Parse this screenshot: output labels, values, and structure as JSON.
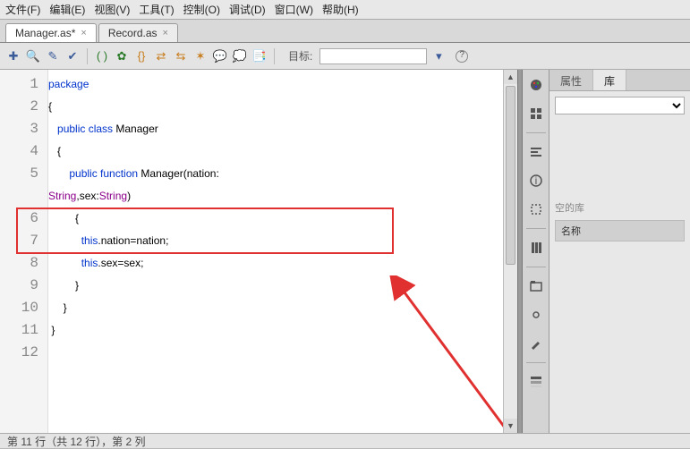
{
  "menu": {
    "file": "文件(F)",
    "edit": "编辑(E)",
    "view": "视图(V)",
    "tools": "工具(T)",
    "control": "控制(O)",
    "debug": "调试(D)",
    "window": "窗口(W)",
    "help": "帮助(H)"
  },
  "tabs": {
    "t1": "Manager.as*",
    "t2": "Record.as"
  },
  "toolbar": {
    "target_label": "目标:",
    "target_value": ""
  },
  "code": {
    "lines": [
      "1",
      "2",
      "3",
      "4",
      "5",
      "6",
      "7",
      "8",
      "9",
      "10",
      "11",
      "12"
    ],
    "l1_kw": "package",
    "l2": "{",
    "l3_kw": "public class",
    "l3_name": " Manager",
    "l4": "{",
    "l5_kw": "public function",
    "l5_name": " Manager",
    "l5_rest": "(nation:",
    "l5b_type1": "String",
    "l5b_mid": ",sex:",
    "l5b_type2": "String",
    "l5b_end": ")",
    "l6": "{",
    "l7_this": "this",
    "l7_rest": ".nation=nation;",
    "l8_this": "this",
    "l8_rest": ".sex=sex;",
    "l9": "}",
    "l10": "}",
    "l11": "}"
  },
  "right": {
    "tab1": "属性",
    "tab2": "库",
    "empty": "空的库",
    "col": "名称"
  },
  "status": {
    "text": "第 11 行（共 12 行），第 2 列"
  }
}
